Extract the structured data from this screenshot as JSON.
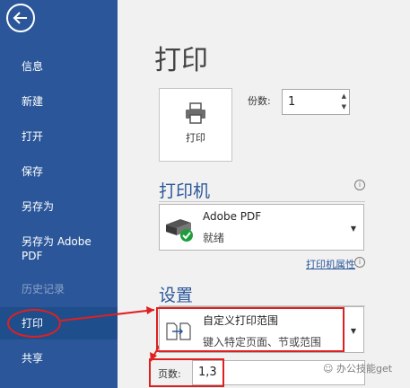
{
  "sidebar": {
    "items": [
      {
        "label": "信息"
      },
      {
        "label": "新建"
      },
      {
        "label": "打开"
      },
      {
        "label": "保存"
      },
      {
        "label": "另存为"
      },
      {
        "label": "另存为 Adobe PDF"
      },
      {
        "label": "历史记录"
      },
      {
        "label": "打印"
      },
      {
        "label": "共享"
      }
    ]
  },
  "main": {
    "title": "打印",
    "print_button_label": "打印",
    "copies_label": "份数:",
    "copies_value": "1",
    "printer_section_title": "打印机",
    "printer_name": "Adobe PDF",
    "printer_status": "就绪",
    "printer_properties_link": "打印机属性",
    "settings_section_title": "设置",
    "range_main": "自定义打印范围",
    "range_sub": "键入特定页面、节或范围",
    "pages_label": "页数:",
    "pages_value": "1,3"
  },
  "watermark": "办公技能get",
  "colors": {
    "sidebar_bg": "#2b579a",
    "sidebar_active_bg": "#1f4e8c",
    "accent": "#2b579a",
    "annotation_red": "#e02020"
  }
}
